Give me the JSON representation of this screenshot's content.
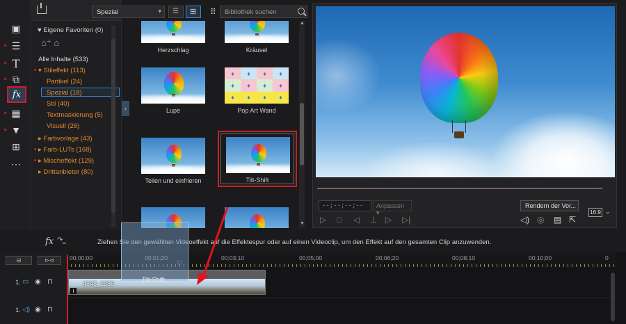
{
  "library": {
    "category_dropdown": "Spezial",
    "search_placeholder": "Bibliothek suchen"
  },
  "tree": {
    "favorites": "Eigene Favoriten (0)",
    "items": [
      {
        "label": "Alle Inhalte (533)",
        "tone": "white"
      },
      {
        "label": "▾ Stileffekt (113)",
        "tone": "orange"
      },
      {
        "label": "Partikel (24)",
        "tone": "orange"
      },
      {
        "label": "Spezial (18)",
        "tone": "orange"
      },
      {
        "label": "Stil (40)",
        "tone": "orange"
      },
      {
        "label": "Textmaskierung (5)",
        "tone": "orange"
      },
      {
        "label": "Visuell (26)",
        "tone": "orange"
      },
      {
        "label": "▸ Farbvorlage (43)",
        "tone": "orange"
      },
      {
        "label": "▸ Farb-LUTs (168)",
        "tone": "orange"
      },
      {
        "label": "▸ Mischeffekt (129)",
        "tone": "orange"
      },
      {
        "label": "▸ Drittanbieter (80)",
        "tone": "orange"
      }
    ]
  },
  "effects": [
    {
      "label": "Herzschlag"
    },
    {
      "label": "Kräusel"
    },
    {
      "label": "Lupe"
    },
    {
      "label": "Pop Art Wand"
    },
    {
      "label": "Teilen und einfrieren"
    },
    {
      "label": "Tilt-Shift"
    }
  ],
  "preview": {
    "timecode": "--;--;--;--",
    "fit_label": "Anpassen ▾",
    "render_button": "Rendern der Vor...",
    "aspect": "16:9"
  },
  "hint_text": "Ziehen Sie den gewählten Videoeffekt auf die Effektespur oder auf einen Videoclip, um den Effekt auf den gesamten Clip anzuwenden.",
  "timeline": {
    "ticks": [
      "00;00;00",
      "00;01;20",
      "00;03;10",
      "00;05;00",
      "00;06;20",
      "00;08;10",
      "00;10;00",
      "0"
    ],
    "track1_label": "1.",
    "track2_label": "1.",
    "clip_name": "4848_1386",
    "drag_effect_label": "Tilt-Shift"
  },
  "colors": {
    "accent_red": "#d01c2a",
    "orange_text": "#e08a2c",
    "selection_blue": "#3e86c8"
  }
}
